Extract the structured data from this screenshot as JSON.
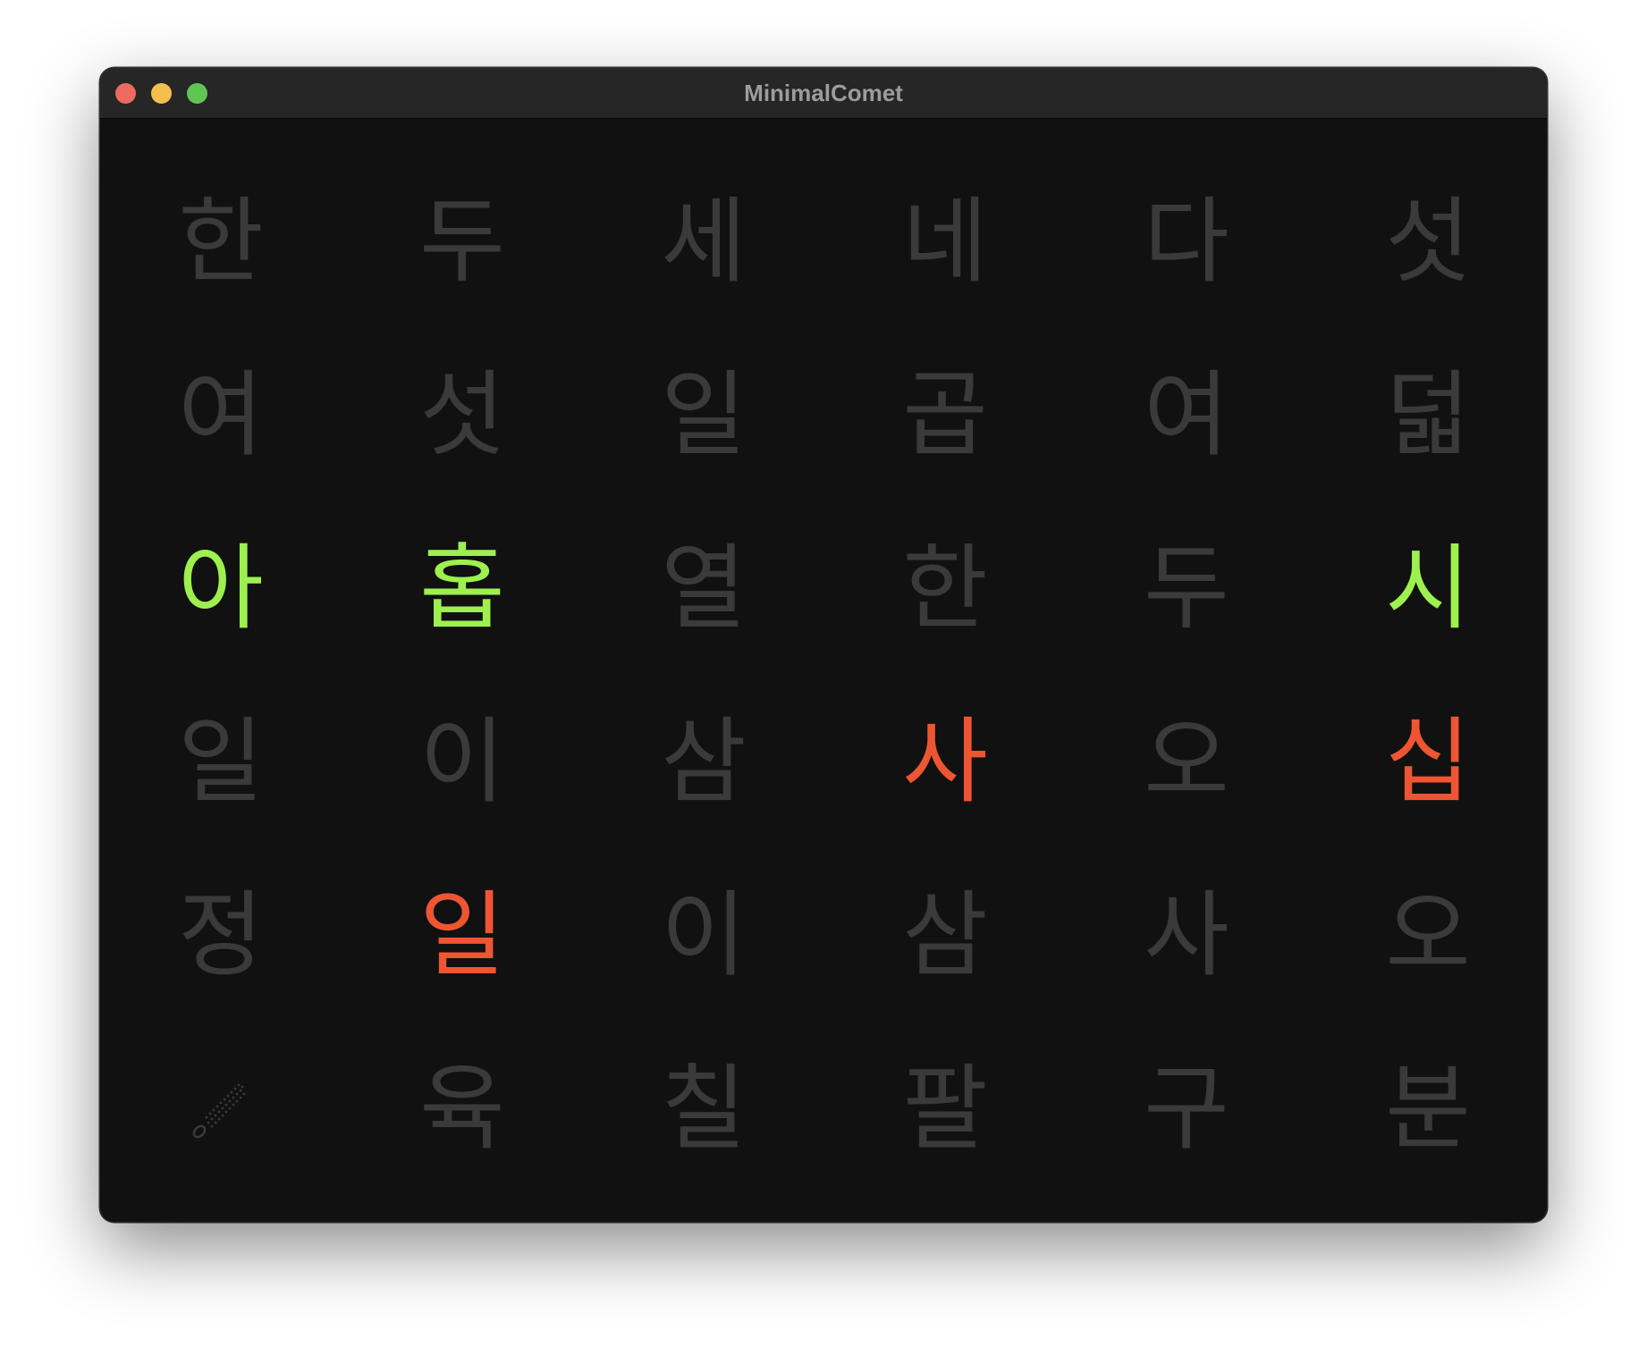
{
  "window": {
    "title": "MinimalComet"
  },
  "colors": {
    "dim": "#3a3a3a",
    "green": "#9ef04e",
    "orange": "#ee5533",
    "close": "#ec6a5e",
    "minimize": "#f4bf4f",
    "maximize": "#61c554"
  },
  "grid": {
    "rows": [
      [
        {
          "char": "한",
          "state": "dim"
        },
        {
          "char": "두",
          "state": "dim"
        },
        {
          "char": "세",
          "state": "dim"
        },
        {
          "char": "네",
          "state": "dim"
        },
        {
          "char": "다",
          "state": "dim"
        },
        {
          "char": "섯",
          "state": "dim"
        }
      ],
      [
        {
          "char": "여",
          "state": "dim"
        },
        {
          "char": "섯",
          "state": "dim"
        },
        {
          "char": "일",
          "state": "dim"
        },
        {
          "char": "곱",
          "state": "dim"
        },
        {
          "char": "여",
          "state": "dim"
        },
        {
          "char": "덟",
          "state": "dim"
        }
      ],
      [
        {
          "char": "아",
          "state": "green"
        },
        {
          "char": "홉",
          "state": "green"
        },
        {
          "char": "열",
          "state": "dim"
        },
        {
          "char": "한",
          "state": "dim"
        },
        {
          "char": "두",
          "state": "dim"
        },
        {
          "char": "시",
          "state": "green"
        }
      ],
      [
        {
          "char": "일",
          "state": "dim"
        },
        {
          "char": "이",
          "state": "dim"
        },
        {
          "char": "삼",
          "state": "dim"
        },
        {
          "char": "사",
          "state": "orange"
        },
        {
          "char": "오",
          "state": "dim"
        },
        {
          "char": "십",
          "state": "orange"
        }
      ],
      [
        {
          "char": "정",
          "state": "dim"
        },
        {
          "char": "일",
          "state": "orange"
        },
        {
          "char": "이",
          "state": "dim"
        },
        {
          "char": "삼",
          "state": "dim"
        },
        {
          "char": "사",
          "state": "dim"
        },
        {
          "char": "오",
          "state": "dim"
        }
      ],
      [
        {
          "char": "",
          "state": "comet",
          "icon": "comet-icon"
        },
        {
          "char": "육",
          "state": "dim"
        },
        {
          "char": "칠",
          "state": "dim"
        },
        {
          "char": "팔",
          "state": "dim"
        },
        {
          "char": "구",
          "state": "dim"
        },
        {
          "char": "분",
          "state": "dim"
        }
      ]
    ]
  }
}
